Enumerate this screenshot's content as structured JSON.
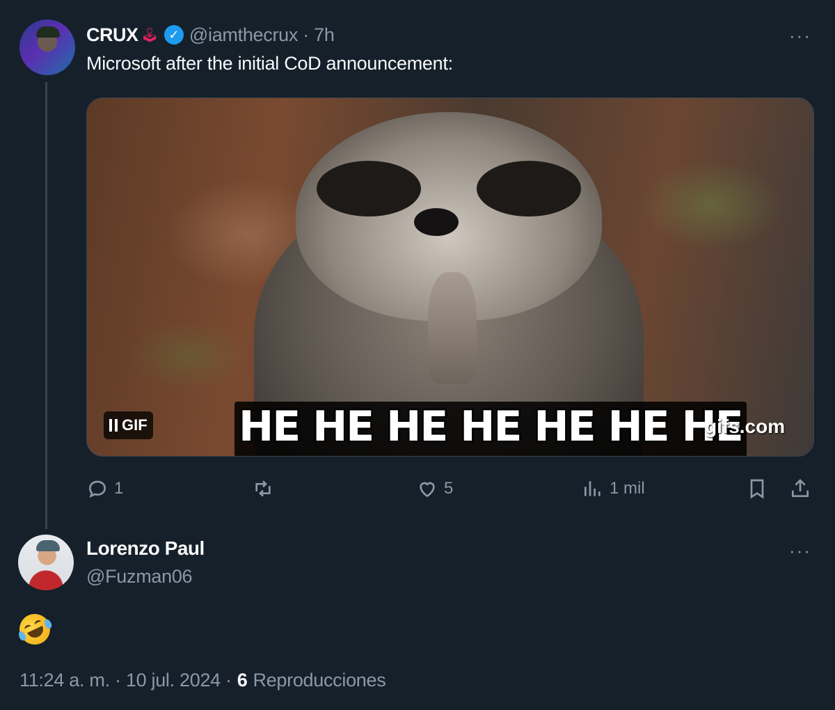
{
  "colors": {
    "background": "#15202b",
    "text_primary": "#f7f9f9",
    "text_secondary": "#8b98a5",
    "verified": "#1d9bf0"
  },
  "tweet": {
    "author_name": "CRUX",
    "author_handle_time": "@iamthecrux · 7h",
    "text": "Microsoft after the initial CoD announcement:",
    "media": {
      "badge_label": "GIF",
      "caption": "HE HE HE HE HE HE HE",
      "watermark": "gifs.com"
    },
    "actions": {
      "reply_count": "1",
      "like_count": "5",
      "views_count": "1 mil"
    }
  },
  "reply": {
    "author_name": "Lorenzo Paul",
    "author_handle": "@Fuzman06",
    "content_icon": "rolling-on-the-floor-laughing-emoji",
    "meta": {
      "timestamp": "11:24 a. m. · 10 jul. 2024 ·",
      "views_count": "6",
      "views_label": "Reproducciones"
    }
  }
}
